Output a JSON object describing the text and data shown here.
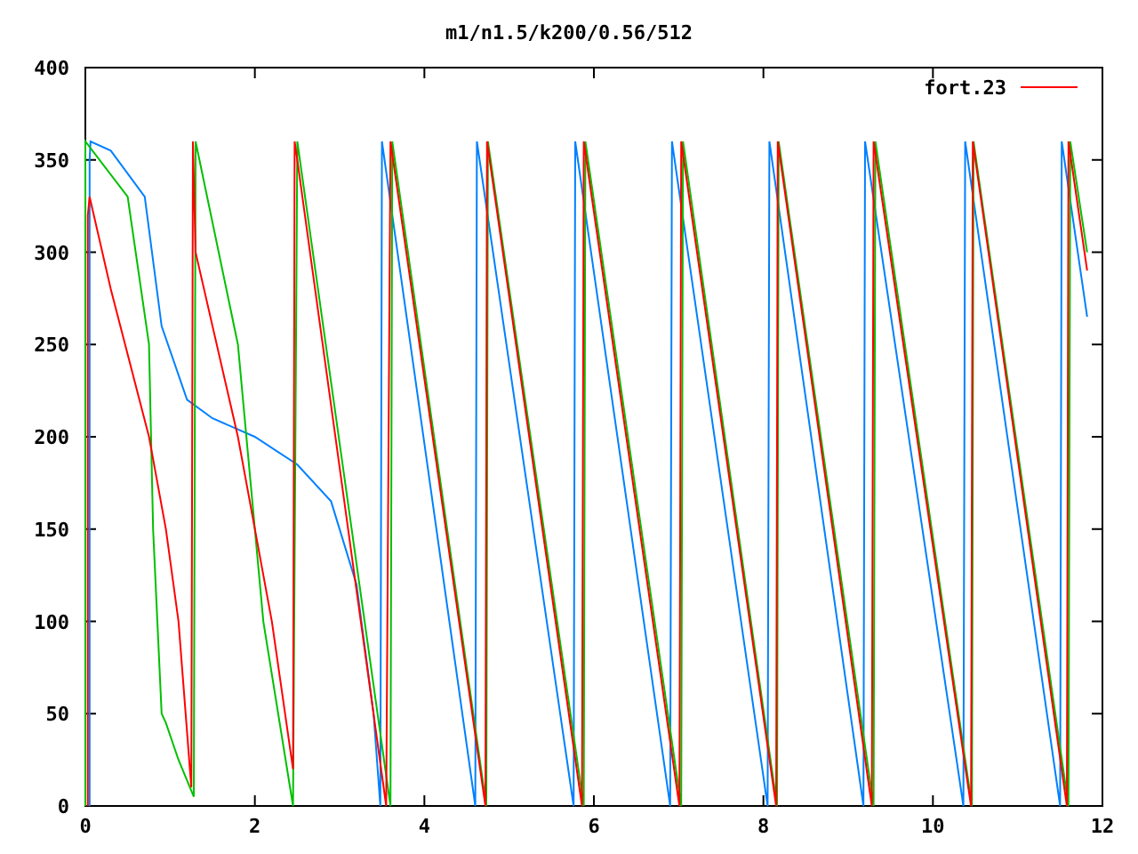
{
  "chart_data": {
    "type": "line",
    "title": "m1/n1.5/k200/0.56/512",
    "xlim": [
      0,
      12
    ],
    "ylim": [
      0,
      400
    ],
    "xticks": [
      0,
      2,
      4,
      6,
      8,
      10,
      12
    ],
    "yticks": [
      0,
      50,
      100,
      150,
      200,
      250,
      300,
      350,
      400
    ],
    "series": [
      {
        "color": "#0080ff",
        "x": [
          0.05,
          0.05,
          0.06,
          0.3,
          0.7,
          0.9,
          1.2,
          1.5,
          2.0,
          2.5,
          2.9,
          3.2,
          3.4,
          3.48,
          3.5,
          4.6,
          4.62,
          5.76,
          5.78,
          6.9,
          6.92,
          8.05,
          8.07,
          9.18,
          9.2,
          10.36,
          10.38,
          11.5,
          11.52,
          11.82
        ],
        "values": [
          0,
          350,
          360,
          355,
          330,
          260,
          220,
          210,
          200,
          185,
          165,
          120,
          50,
          0,
          360,
          0,
          360,
          0,
          360,
          0,
          360,
          0,
          360,
          0,
          360,
          0,
          360,
          0,
          360,
          265
        ]
      },
      {
        "color": "#00c000",
        "x": [
          0,
          0,
          0.5,
          0.75,
          0.8,
          0.85,
          0.9,
          0.95,
          1.1,
          1.28,
          1.3,
          1.8,
          2.1,
          2.45,
          2.5,
          3.6,
          3.62,
          4.73,
          4.75,
          5.88,
          5.9,
          7.03,
          7.05,
          8.16,
          8.18,
          9.3,
          9.32,
          10.46,
          10.48,
          11.6,
          11.62,
          11.82
        ],
        "values": [
          0,
          360,
          330,
          250,
          150,
          100,
          50,
          45,
          25,
          5,
          360,
          250,
          100,
          0,
          360,
          0,
          360,
          0,
          360,
          0,
          360,
          0,
          360,
          0,
          360,
          0,
          360,
          0,
          360,
          0,
          360,
          300
        ]
      },
      {
        "name": "fort.23",
        "color": "#ff0000",
        "x": [
          0.03,
          0.03,
          0.05,
          0.3,
          0.75,
          0.95,
          1.1,
          1.25,
          1.27,
          1.3,
          1.8,
          2.2,
          2.45,
          2.47,
          2.5,
          3.55,
          3.6,
          4.72,
          4.74,
          5.86,
          5.88,
          7.01,
          7.03,
          8.15,
          8.17,
          9.28,
          9.3,
          10.45,
          10.47,
          11.58,
          11.6,
          11.82
        ],
        "values": [
          0,
          320,
          330,
          280,
          200,
          150,
          100,
          10,
          360,
          300,
          200,
          100,
          20,
          360,
          350,
          0,
          360,
          0,
          360,
          0,
          360,
          0,
          360,
          0,
          360,
          0,
          360,
          0,
          360,
          0,
          360,
          290
        ]
      }
    ]
  }
}
